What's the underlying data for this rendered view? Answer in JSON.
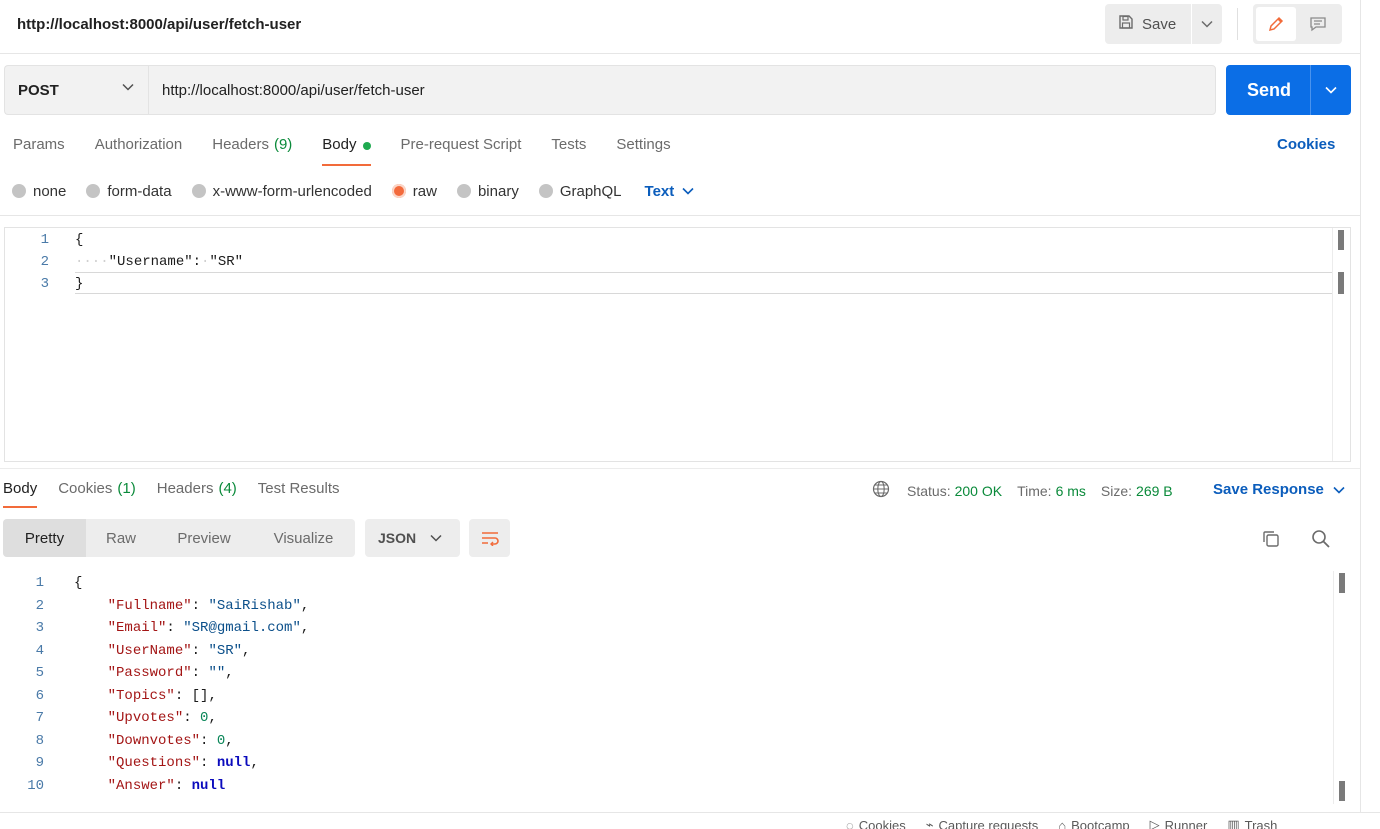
{
  "header": {
    "title": "http://localhost:8000/api/user/fetch-user",
    "save_label": "Save"
  },
  "request": {
    "method": "POST",
    "url": "http://localhost:8000/api/user/fetch-user",
    "send_label": "Send",
    "tabs": [
      {
        "label": "Params",
        "count": ""
      },
      {
        "label": "Authorization",
        "count": ""
      },
      {
        "label": "Headers",
        "count": "(9)"
      },
      {
        "label": "Body",
        "count": ""
      },
      {
        "label": "Pre-request Script",
        "count": ""
      },
      {
        "label": "Tests",
        "count": ""
      },
      {
        "label": "Settings",
        "count": ""
      }
    ],
    "cookies_label": "Cookies",
    "body_types": [
      "none",
      "form-data",
      "x-www-form-urlencoded",
      "raw",
      "binary",
      "GraphQL"
    ],
    "body_format": "Text",
    "body_lines": [
      {
        "n": "1",
        "text": "{"
      },
      {
        "n": "2",
        "key": "\"Username\"",
        "value": "\"SR\""
      },
      {
        "n": "3",
        "text": "}"
      }
    ]
  },
  "response": {
    "tabs": [
      {
        "label": "Body",
        "count": ""
      },
      {
        "label": "Cookies",
        "count": "(1)"
      },
      {
        "label": "Headers",
        "count": "(4)"
      },
      {
        "label": "Test Results",
        "count": ""
      }
    ],
    "status_label": "Status:",
    "status_value": "200 OK",
    "time_label": "Time:",
    "time_value": "6 ms",
    "size_label": "Size:",
    "size_value": "269 B",
    "save_response_label": "Save Response",
    "views": [
      "Pretty",
      "Raw",
      "Preview",
      "Visualize"
    ],
    "format": "JSON",
    "lines": [
      {
        "n": "1",
        "text": "{"
      },
      {
        "n": "2",
        "key": "\"Fullname\"",
        "value": "\"SaiRishab\"",
        "type": "str",
        "comma": ","
      },
      {
        "n": "3",
        "key": "\"Email\"",
        "value": "\"SR@gmail.com\"",
        "type": "str",
        "comma": ","
      },
      {
        "n": "4",
        "key": "\"UserName\"",
        "value": "\"SR\"",
        "type": "str",
        "comma": ","
      },
      {
        "n": "5",
        "key": "\"Password\"",
        "value": "\"\"",
        "type": "str",
        "comma": ","
      },
      {
        "n": "6",
        "key": "\"Topics\"",
        "value": "[]",
        "type": "punc",
        "comma": ","
      },
      {
        "n": "7",
        "key": "\"Upvotes\"",
        "value": "0",
        "type": "num",
        "comma": ","
      },
      {
        "n": "8",
        "key": "\"Downvotes\"",
        "value": "0",
        "type": "num",
        "comma": ","
      },
      {
        "n": "9",
        "key": "\"Questions\"",
        "value": "null",
        "type": "null",
        "comma": ","
      },
      {
        "n": "10",
        "key": "\"Answer\"",
        "value": "null",
        "type": "null",
        "comma": ""
      }
    ]
  },
  "footer": {
    "items": [
      "Cookies",
      "Capture requests",
      "Bootcamp",
      "Runner",
      "Trash"
    ]
  },
  "colors": {
    "accent_orange": "#f26b3a",
    "send_blue": "#0b6ee6",
    "link_blue": "#0b5dbc",
    "status_green": "#0a8a3a"
  }
}
